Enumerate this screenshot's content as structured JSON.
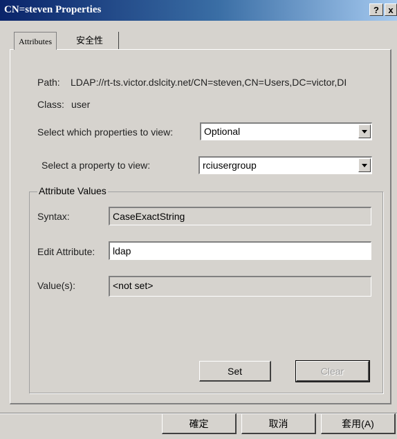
{
  "window": {
    "title": "CN=steven Properties",
    "help_label": "?",
    "close_label": "x"
  },
  "tabs": [
    {
      "label": "Attributes"
    },
    {
      "label": "安全性"
    }
  ],
  "info": {
    "path_label": "Path:",
    "path_value": "LDAP://rt-ts.victor.dslcity.net/CN=steven,CN=Users,DC=victor,DI",
    "class_label": "Class:",
    "class_value": "user"
  },
  "selectors": {
    "properties_label": "Select which properties to view:",
    "properties_value": "Optional",
    "property_label": "Select a property to view:",
    "property_value": "rciusergroup"
  },
  "attribute_values": {
    "group_title": "Attribute Values",
    "syntax_label": "Syntax:",
    "syntax_value": "CaseExactString",
    "edit_label": "Edit Attribute:",
    "edit_value": "ldap",
    "values_label": "Value(s):",
    "values_value": "<not set>",
    "set_label": "Set",
    "clear_label": "Clear"
  },
  "footer": {
    "ok_label": "確定",
    "cancel_label": "取消",
    "apply_label": "套用(A)"
  }
}
